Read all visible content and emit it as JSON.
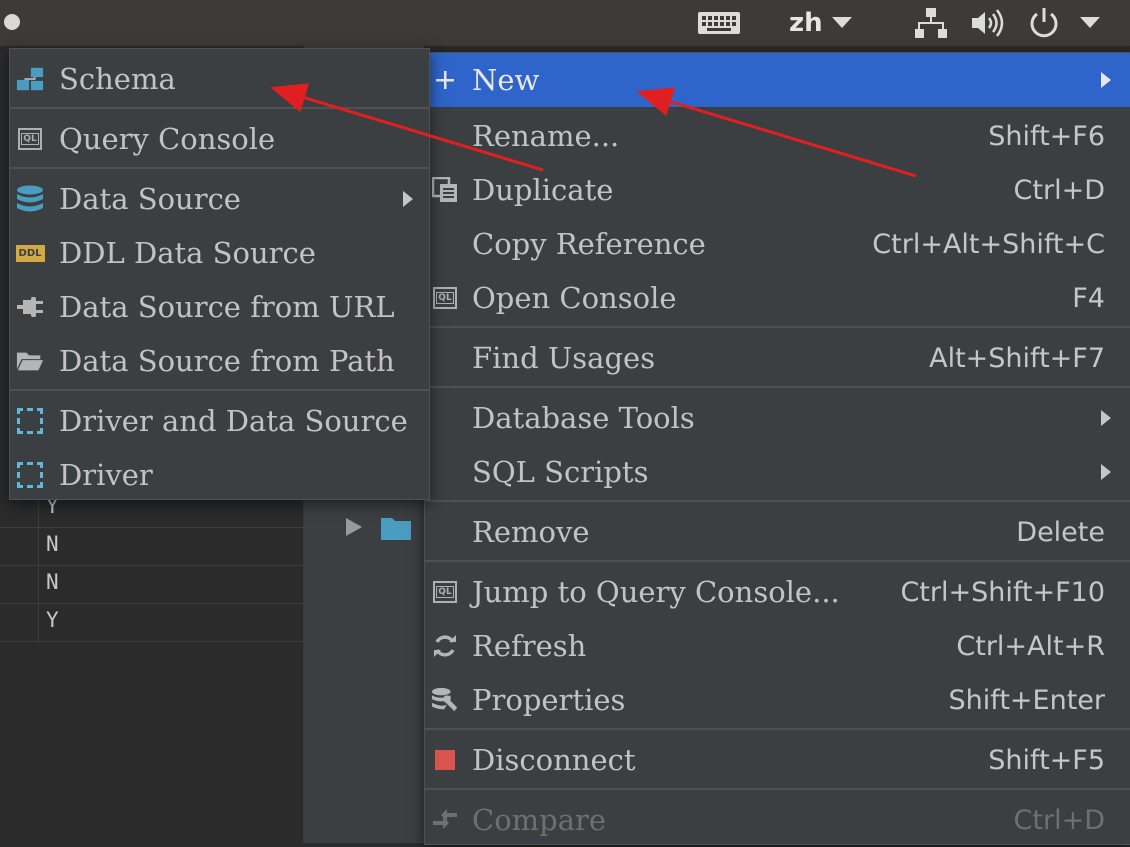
{
  "topbar": {
    "language": "zh",
    "icons": [
      "keyboard-icon",
      "chevron-down-icon",
      "network-icon",
      "volume-icon",
      "power-icon",
      "chevron-down-icon"
    ]
  },
  "grid": {
    "rows": [
      "Y",
      "N",
      "N",
      "Y"
    ]
  },
  "main_menu": {
    "items": [
      {
        "label": "New",
        "shortcut": "",
        "icon": "plus-icon"
      },
      {
        "label": "Rename...",
        "shortcut": "Shift+F6"
      },
      {
        "label": "Duplicate",
        "shortcut": "Ctrl+D",
        "icon": "duplicate-icon"
      },
      {
        "label": "Copy Reference",
        "shortcut": "Ctrl+Alt+Shift+C"
      },
      {
        "label": "Open Console",
        "shortcut": "F4",
        "icon": "console-icon"
      },
      {
        "label": "Find Usages",
        "shortcut": "Alt+Shift+F7"
      },
      {
        "label": "Database Tools",
        "shortcut": ""
      },
      {
        "label": "SQL Scripts",
        "shortcut": ""
      },
      {
        "label": "Remove",
        "shortcut": "Delete"
      },
      {
        "label": "Jump to Query Console...",
        "shortcut": "Ctrl+Shift+F10",
        "icon": "console-icon"
      },
      {
        "label": "Refresh",
        "shortcut": "Ctrl+Alt+R",
        "icon": "refresh-icon"
      },
      {
        "label": "Properties",
        "shortcut": "Shift+Enter",
        "icon": "properties-icon"
      },
      {
        "label": "Disconnect",
        "shortcut": "Shift+F5",
        "icon": "stop-icon"
      },
      {
        "label": "Compare",
        "shortcut": "Ctrl+D",
        "icon": "compare-icon"
      }
    ]
  },
  "sub_menu": {
    "items": [
      {
        "label": "Schema",
        "icon": "schema-icon"
      },
      {
        "label": "Query Console",
        "icon": "console-icon"
      },
      {
        "label": "Data Source",
        "icon": "database-icon"
      },
      {
        "label": "DDL Data Source",
        "icon": "ddl-icon",
        "icon_text": "DDL"
      },
      {
        "label": "Data Source from URL",
        "icon": "plug-icon"
      },
      {
        "label": "Data Source from Path",
        "icon": "folder-icon"
      },
      {
        "label": "Driver and Data Source",
        "icon": "driver-icon"
      },
      {
        "label": "Driver",
        "icon": "driver-icon"
      }
    ]
  },
  "colors": {
    "highlight": "#2f65ca",
    "menu_bg": "#3c3f41",
    "arrow": "#e02020",
    "disconnect": "#d9534f",
    "driver_icon": "#5fb8d8"
  }
}
